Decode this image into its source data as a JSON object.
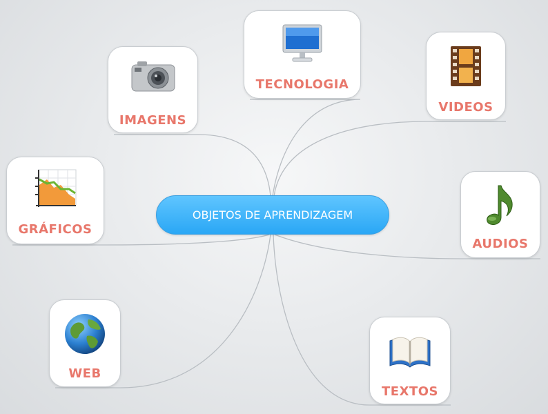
{
  "central_topic": "OBJETOS DE APRENDIZAGEM",
  "accent_colors": {
    "label": "#e8776b",
    "central": "#2aa7f5",
    "connector": "#b9bec3"
  },
  "branches": {
    "tecnologia": {
      "label": "TECNOLOGIA",
      "icon": "monitor-icon"
    },
    "imagens": {
      "label": "IMAGENS",
      "icon": "camera-icon"
    },
    "videos": {
      "label": "VIDEOS",
      "icon": "film-strip-icon"
    },
    "graficos": {
      "label": "GRÁFICOS",
      "icon": "chart-icon"
    },
    "audios": {
      "label": "AUDIOS",
      "icon": "music-note-icon"
    },
    "web": {
      "label": "WEB",
      "icon": "globe-icon"
    },
    "textos": {
      "label": "TEXTOS",
      "icon": "book-icon"
    }
  }
}
